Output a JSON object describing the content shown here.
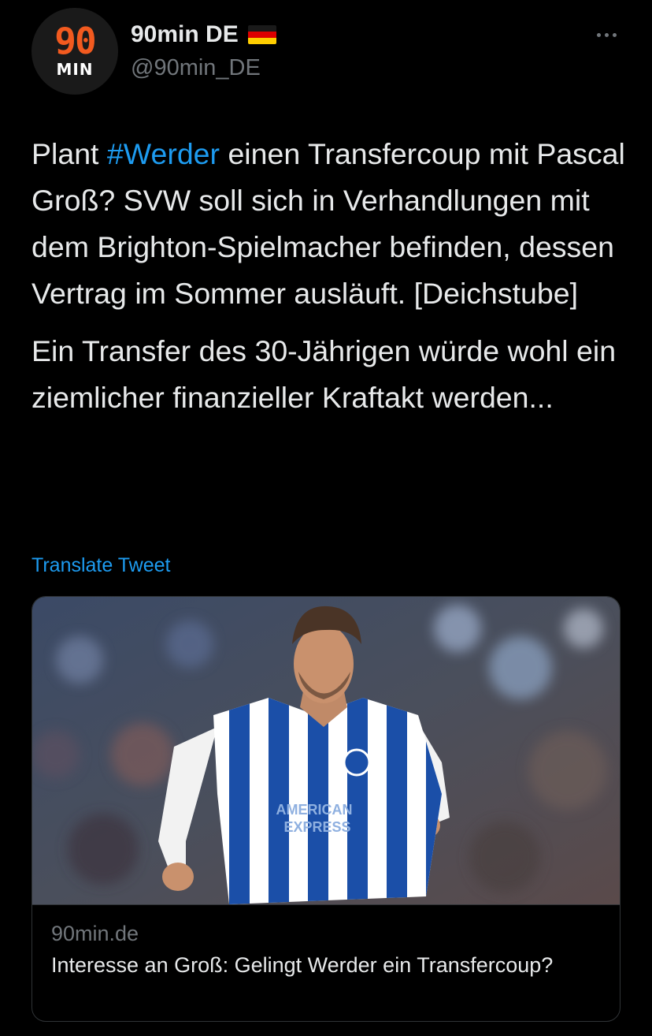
{
  "author": {
    "display_name": "90min DE",
    "handle": "@90min_DE",
    "avatar_logo_top": "90",
    "avatar_logo_bottom": "MIN",
    "flag_icon": "germany-flag-icon"
  },
  "tweet": {
    "text_p1_before": "Plant ",
    "hashtag": "#Werder",
    "text_p1_after": " einen Transfercoup mit Pascal Groß? SVW soll sich in Verhandlungen mit dem Brighton-Spielmacher befinden, dessen Vertrag im Sommer ausläuft. [Deichstube]",
    "text_p2": "Ein Transfer des 30-Jährigen würde wohl ein ziemlicher finanzieller Kraftakt werden...",
    "translate_label": "Translate Tweet"
  },
  "card": {
    "image_icon": "football-player-photo",
    "shirt_sponsor_line1": "AMERICAN",
    "shirt_sponsor_line2": "EXPRESS",
    "domain": "90min.de",
    "title": "Interesse an Groß: Gelingt Werder ein Transfercoup?"
  },
  "colors": {
    "background": "#000000",
    "text": "#e7e9ea",
    "secondary": "#71767b",
    "link": "#1d9bf0",
    "brand_orange": "#f25a1f"
  }
}
